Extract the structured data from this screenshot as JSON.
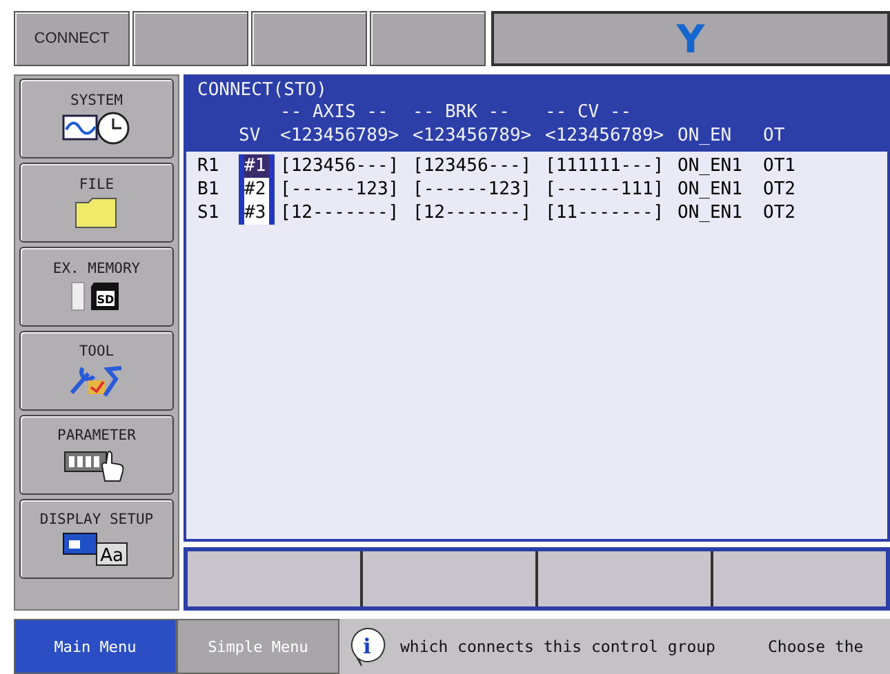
{
  "top_bar": {
    "buttons": [
      "CONNECT"
    ],
    "logo": "Y"
  },
  "sidebar": {
    "items": [
      {
        "label": "SYSTEM",
        "kind": "system"
      },
      {
        "label": "FILE",
        "kind": "file"
      },
      {
        "label": "EX. MEMORY",
        "kind": "memory",
        "icon_text": "SD"
      },
      {
        "label": "TOOL",
        "kind": "tool"
      },
      {
        "label": "PARAMETER",
        "kind": "parameter"
      },
      {
        "label": "DISPLAY SETUP",
        "kind": "display",
        "icon_text": "Aa"
      }
    ]
  },
  "panel": {
    "title": "CONNECT(STO)",
    "group_headers": [
      "-- AXIS --",
      "-- BRK --",
      "-- CV --"
    ],
    "columns": [
      "SV",
      "<123456789>",
      "<123456789>",
      "<123456789>",
      "ON_EN",
      "OT"
    ],
    "rows": [
      {
        "label": "R1",
        "sv": "#1",
        "selected": true,
        "axis": "[123456---]",
        "brk": "[123456---]",
        "cv": "[111111---]",
        "on_en": "ON_EN1",
        "ot": "OT1"
      },
      {
        "label": "B1",
        "sv": "#2",
        "selected": false,
        "axis": "[------123]",
        "brk": "[------123]",
        "cv": "[------111]",
        "on_en": "ON_EN1",
        "ot": "OT2"
      },
      {
        "label": "S1",
        "sv": "#3",
        "selected": false,
        "axis": "[12-------]",
        "brk": "[12-------]",
        "cv": "[11-------]",
        "on_en": "ON_EN1",
        "ot": "OT2"
      }
    ]
  },
  "bottom_bar": {
    "tabs": [
      {
        "label": "Main Menu",
        "selected": true
      },
      {
        "label": "Simple Menu",
        "selected": false
      }
    ],
    "info_icon": "i",
    "messages": [
      "which connects this control group",
      "Choose the"
    ]
  }
}
